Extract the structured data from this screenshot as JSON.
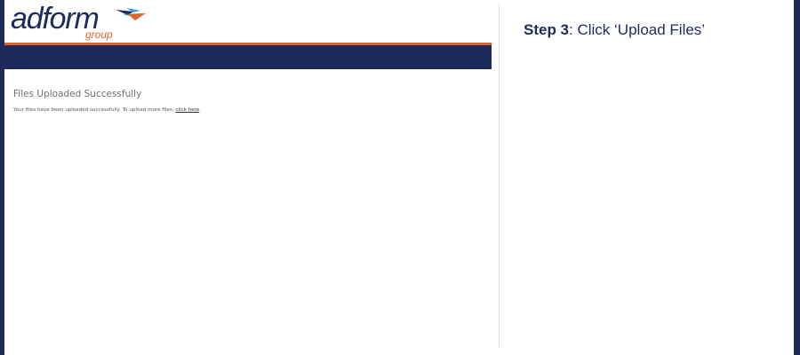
{
  "brand": {
    "logo_word": "adform",
    "logo_sub": "group"
  },
  "page": {
    "success_title": "Files Uploaded Successfully",
    "success_message": "Your files have been uploaded successfully. To upload more files, ",
    "link_text": "click here",
    "trailing": "."
  },
  "instruction": {
    "step_label": "Step 3",
    "text": ": Click ‘Upload Files’"
  },
  "colors": {
    "navy": "#1e2a5c",
    "orange": "#e2632a"
  },
  "icons": [
    "adform-arrow-icon"
  ]
}
